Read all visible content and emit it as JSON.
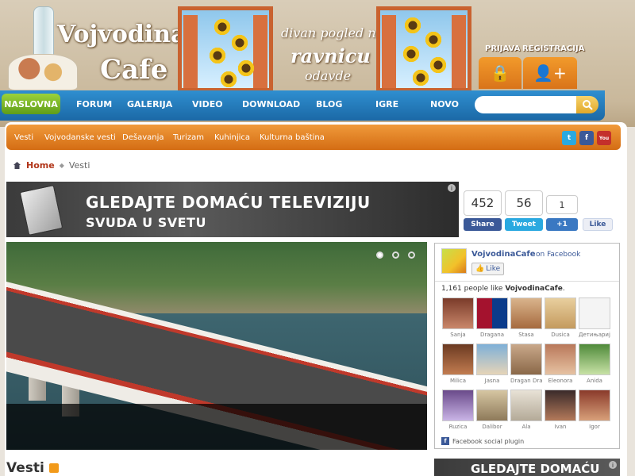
{
  "header": {
    "logo_line1": "Vojvodina",
    "logo_line2": "Cafe",
    "tagline_line1": "divan pogled na",
    "tagline_line2": "ravnicu",
    "tagline_line3": "odavde",
    "login_label": "PRIJAVA",
    "register_label": "REGISTRACIJA"
  },
  "nav": {
    "items": [
      "NASLOVNA",
      "FORUM",
      "GALERIJA",
      "VIDEO",
      "DOWNLOAD",
      "BLOG",
      "IGRE",
      "NOVO"
    ],
    "search_placeholder": ""
  },
  "subnav": {
    "items": [
      "Vesti",
      "Vojvodanske vesti",
      "Dešavanja",
      "Turizam",
      "Kuhinjica",
      "Kulturna baština"
    ]
  },
  "breadcrumb": {
    "home": "Home",
    "current": "Vesti"
  },
  "banner": {
    "line1": "GLEDAJTE DOMAĆU TELEVIZIJU",
    "line2": "SVUDA U SVETU",
    "ad_marker": "i"
  },
  "share": {
    "facebook_count": "452",
    "twitter_count": "56",
    "gplus_count": "1",
    "facebook_label": "Share",
    "twitter_label": "Tweet",
    "gplus_label": "+1",
    "like_label": "Like"
  },
  "facebook_box": {
    "page_name": "VojvodinaCafe",
    "on_facebook": "on Facebook",
    "like_label": "Like",
    "count_text": "1,161 people like",
    "count_name": "VojvodinaCafe",
    "friends": [
      "Sanja",
      "Dragana",
      "Stasa",
      "Dusica",
      "Детињарије",
      "Milica",
      "Jasna",
      "Dragan Draj",
      "Eleonora",
      "Anida",
      "Ruzica",
      "Dalibor",
      "Ala",
      "Ivan",
      "Igor"
    ],
    "footer": "Facebook social plugin"
  },
  "section": {
    "title": "Vesti"
  },
  "banner2": {
    "text": "GLEDAJTE DOMAĆU"
  },
  "colors": {
    "nav_blue": "#1b69a6",
    "nav_green": "#5f9d19",
    "subnav_orange": "#d46d14",
    "breadcrumb_red": "#b2361a",
    "facebook_blue": "#3b5998",
    "twitter_blue": "#2aa9e0"
  }
}
